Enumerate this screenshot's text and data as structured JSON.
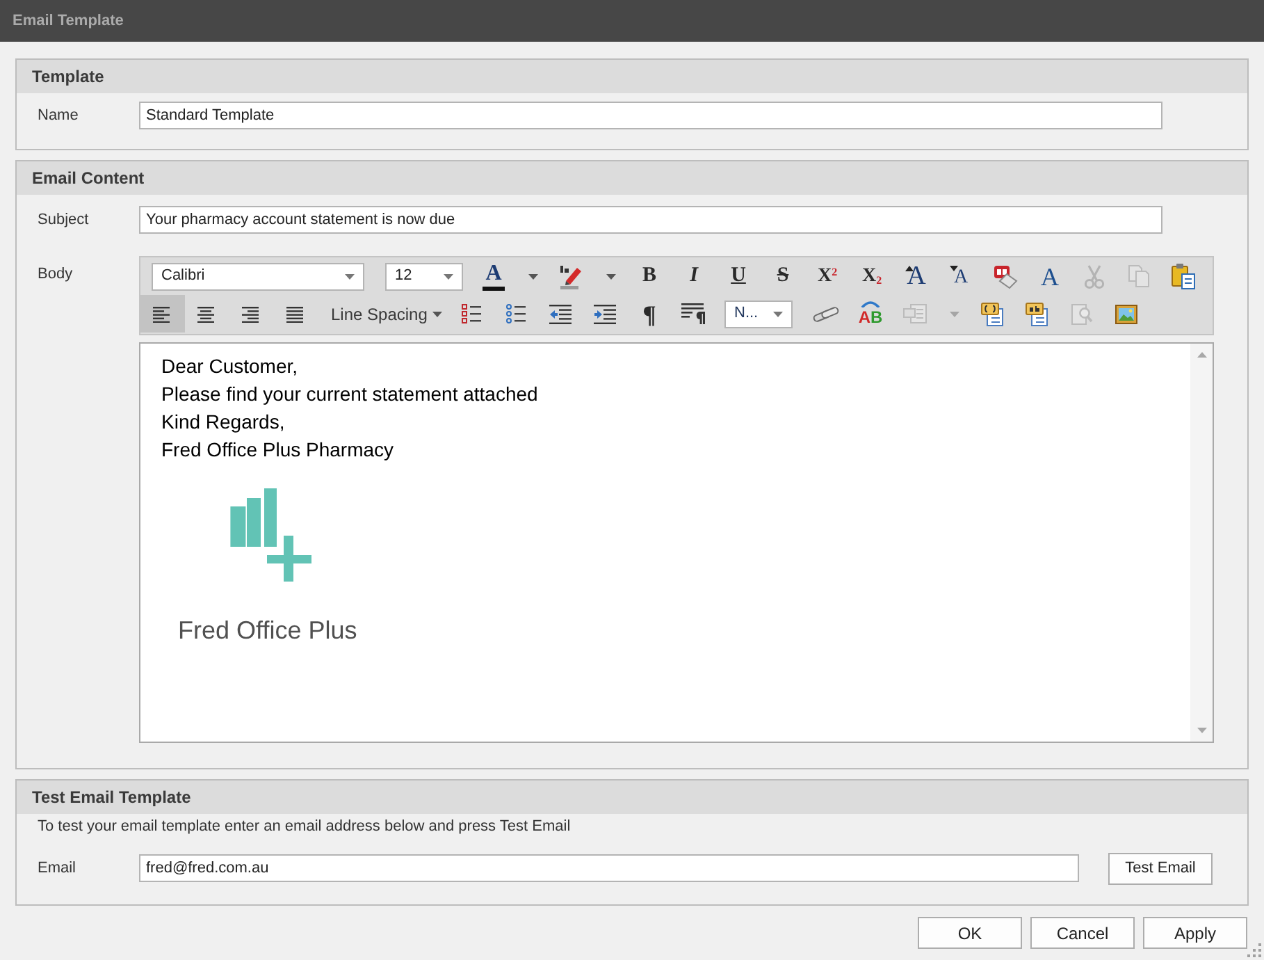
{
  "window": {
    "title": "Email Template"
  },
  "template": {
    "title": "Template",
    "name": {
      "label": "Name",
      "value": "Standard Template"
    }
  },
  "email_content": {
    "title": "Email Content",
    "subject": {
      "label": "Subject",
      "value": "Your pharmacy account statement is now due"
    },
    "body_label": "Body",
    "toolbar": {
      "upper_row": [
        {
          "kind": "fontname",
          "value": "Calibri"
        },
        {
          "kind": "fontsize",
          "value": "12"
        },
        {
          "kind": "fontcolor",
          "glyph": "A",
          "disabled": false
        },
        {
          "kind": "caret",
          "disabled": false
        },
        {
          "kind": "highlight",
          "disabled": false
        },
        {
          "kind": "caret",
          "disabled": false
        },
        {
          "kind": "bold",
          "glyph": "B",
          "disabled": false
        },
        {
          "kind": "italic",
          "glyph": "I",
          "disabled": false
        },
        {
          "kind": "underline",
          "glyph": "U",
          "disabled": false
        },
        {
          "kind": "strike",
          "glyph": "S",
          "disabled": false
        },
        {
          "kind": "superscript",
          "glyph": "X$^{2}$",
          "disabled": false
        },
        {
          "kind": "subscript",
          "glyph": "X$_{2}$",
          "disabled": false
        },
        {
          "kind": "grow",
          "glyph": "A",
          "disabled": false
        },
        {
          "kind": "shrink",
          "glyph": "A",
          "disabled": false
        },
        {
          "kind": "clear",
          "disabled": false
        },
        {
          "kind": "font",
          "glyph": "A",
          "disabled": false
        },
        {
          "kind": "cut",
          "disabled": true
        },
        {
          "kind": "copy",
          "disabled": true
        },
        {
          "kind": "paste",
          "disabled": false
        }
      ],
      "lower_row": [
        {
          "kind": "alignleft",
          "selected": true,
          "disabled": false
        },
        {
          "kind": "center",
          "selected": false,
          "disabled": false
        },
        {
          "kind": "alignright",
          "selected": false,
          "disabled": false
        },
        {
          "kind": "justify",
          "selected": false,
          "disabled": false
        },
        {
          "kind": "menu",
          "label": "Line Spacing",
          "disabled": false
        },
        {
          "kind": "numbered",
          "disabled": false
        },
        {
          "kind": "bullets",
          "disabled": false
        },
        {
          "kind": "outdent",
          "disabled": false
        },
        {
          "kind": "indent",
          "disabled": false
        },
        {
          "kind": "pilcrow",
          "glyph": "¶",
          "disabled": false
        },
        {
          "kind": "marks",
          "disabled": false
        },
        {
          "kind": "style",
          "value": "N..."
        },
        {
          "kind": "link",
          "disabled": false
        },
        {
          "kind": "spelling",
          "glyph": "AB",
          "disabled": false
        },
        {
          "kind": "insert",
          "disabled": true
        },
        {
          "kind": "caret",
          "disabled": true
        },
        {
          "kind": "field",
          "disabled": false
        },
        {
          "kind": "textfield",
          "disabled": false
        },
        {
          "kind": "find",
          "disabled": true
        },
        {
          "kind": "image",
          "disabled": false
        }
      ]
    },
    "editor": {
      "lines": [
        "Dear Customer,",
        "Please find your current statement attached",
        "Kind Regards,",
        "Fred Office Plus Pharmacy"
      ],
      "logo_text": "Fred Office Plus"
    }
  },
  "test_email": {
    "title": "Test Email Template",
    "hint": "To test your email template enter an email address below and press Test Email",
    "email": {
      "label": "Email",
      "value": "fred@fred.com.au"
    },
    "button": "Test Email"
  },
  "buttons": [
    {
      "label": "OK"
    },
    {
      "label": "Cancel"
    },
    {
      "label": "Apply"
    }
  ]
}
